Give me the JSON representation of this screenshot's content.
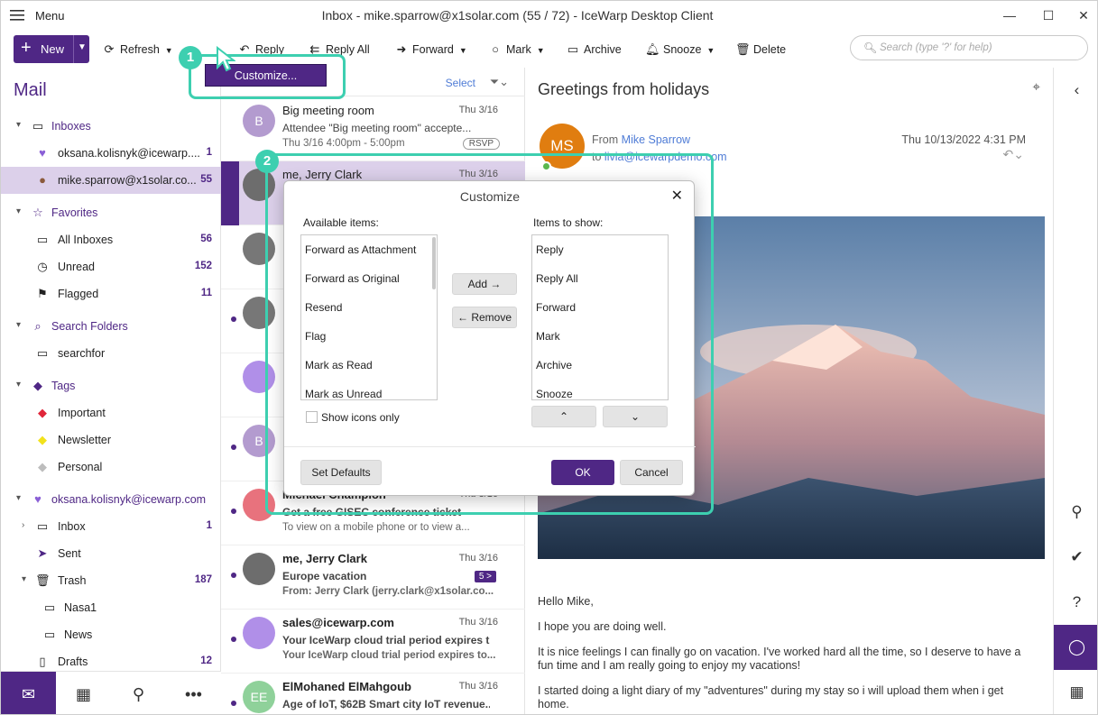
{
  "window": {
    "menu_label": "Menu",
    "title": "Inbox - mike.sparrow@x1solar.com (55 / 72) - IceWarp Desktop Client",
    "min": "—",
    "max": "☐",
    "close": "✕"
  },
  "toolbar": {
    "new": "New",
    "refresh": "Refresh",
    "reply": "Reply",
    "reply_all": "Reply All",
    "forward": "Forward",
    "mark": "Mark",
    "archive": "Archive",
    "snooze": "Snooze",
    "delete": "Delete",
    "search_placeholder": "Search (type '?' for help)",
    "customize_popup": "Customize..."
  },
  "callouts": {
    "one": "1",
    "two": "2"
  },
  "sidebar": {
    "title": "Mail",
    "items": [
      {
        "label": "Inboxes",
        "count": "",
        "type": "hdr"
      },
      {
        "label": "oksana.kolisnyk@icewarp....",
        "count": "1"
      },
      {
        "label": "mike.sparrow@x1solar.co...",
        "count": "55"
      },
      {
        "label": "Favorites",
        "count": "",
        "type": "hdr"
      },
      {
        "label": "All Inboxes",
        "count": "56"
      },
      {
        "label": "Unread",
        "count": "152"
      },
      {
        "label": "Flagged",
        "count": "11"
      },
      {
        "label": "Search Folders",
        "count": "",
        "type": "hdr"
      },
      {
        "label": "searchfor",
        "count": ""
      },
      {
        "label": "Tags",
        "count": "",
        "type": "hdr"
      },
      {
        "label": "Important",
        "count": ""
      },
      {
        "label": "Newsletter",
        "count": ""
      },
      {
        "label": "Personal",
        "count": ""
      },
      {
        "label": "oksana.kolisnyk@icewarp.com",
        "count": "",
        "type": "hdr"
      },
      {
        "label": "Inbox",
        "count": "1"
      },
      {
        "label": "Sent",
        "count": ""
      },
      {
        "label": "Trash",
        "count": "187"
      },
      {
        "label": "Nasa1",
        "count": ""
      },
      {
        "label": "News",
        "count": ""
      },
      {
        "label": "Drafts",
        "count": "12"
      }
    ]
  },
  "list": {
    "select": "Select",
    "messages": [
      {
        "avatar": "B",
        "from": "Big meeting room",
        "date": "Thu 3/16",
        "subject": "Attendee \"Big meeting room\" accepte...",
        "preview": "Thu 3/16 4:00pm - 5:00pm",
        "rsvp": "RSVP"
      },
      {
        "avatar": "",
        "from": "me, Jerry Clark",
        "date": "Thu 3/16",
        "subject": "",
        "preview": ""
      },
      {
        "avatar": "",
        "from": "",
        "date": "",
        "subject": "",
        "preview": ""
      },
      {
        "avatar": "",
        "from": "",
        "date": "",
        "subject": "",
        "preview": ""
      },
      {
        "avatar": "",
        "from": "",
        "date": "",
        "subject": "",
        "preview": ""
      },
      {
        "avatar": "B",
        "from": "",
        "date": "",
        "subject": "",
        "preview": ""
      },
      {
        "avatar": "",
        "from": "Michael Champion",
        "date": "Thu 3/16",
        "subject": "Get a free GISEC conference ticket",
        "preview": "To view on a mobile phone or to view a..."
      },
      {
        "avatar": "",
        "from": "me, Jerry Clark",
        "date": "Thu 3/16",
        "subject": "Europe vacation",
        "preview": "From: Jerry Clark (jerry.clark@x1solar.co...",
        "badge": "5 >"
      },
      {
        "avatar": "",
        "from": "sales@icewarp.com",
        "date": "Thu 3/16",
        "subject": "Your IceWarp cloud trial period expires t...",
        "preview": "Your IceWarp cloud trial period expires to..."
      },
      {
        "avatar": "EE",
        "from": "ElMohaned ElMahgoub",
        "date": "Thu 3/16",
        "subject": "Age of IoT, $62B Smart city IoT revenue...",
        "preview": ""
      }
    ]
  },
  "reading": {
    "subject": "Greetings from holidays",
    "avatar": "MS",
    "from_prefix": "From",
    "from_name": "Mike Sparrow",
    "to_prefix": "to",
    "to_addr": "livia@icewarpdemo.com",
    "date": "Thu 10/13/2022 4:31 PM",
    "body": [
      "Hello Mike,",
      "I hope you are doing well.",
      "It is nice feelings I can finally go on vacation. I've worked hard all the time, so I deserve to have a fun time and I am really going to enjoy my vacations!",
      "I started doing a light diary of my \"adventures\" during my stay so i will upload them when i get home."
    ]
  },
  "dialog": {
    "title": "Customize",
    "available_label": "Available items:",
    "show_label": "Items to show:",
    "available": [
      "Forward as Attachment",
      "Forward as Original",
      "Resend",
      "Flag",
      "Mark as Read",
      "Mark as Unread"
    ],
    "shown": [
      "Reply",
      "Reply All",
      "Forward",
      "Mark",
      "Archive",
      "Snooze"
    ],
    "add": "Add →",
    "remove": "← Remove",
    "icons_only": "Show icons only",
    "set_defaults": "Set Defaults",
    "ok": "OK",
    "cancel": "Cancel"
  },
  "colors": {
    "brand": "#4f2785",
    "callout": "#3dcfb0",
    "link": "#4f7cd6"
  }
}
